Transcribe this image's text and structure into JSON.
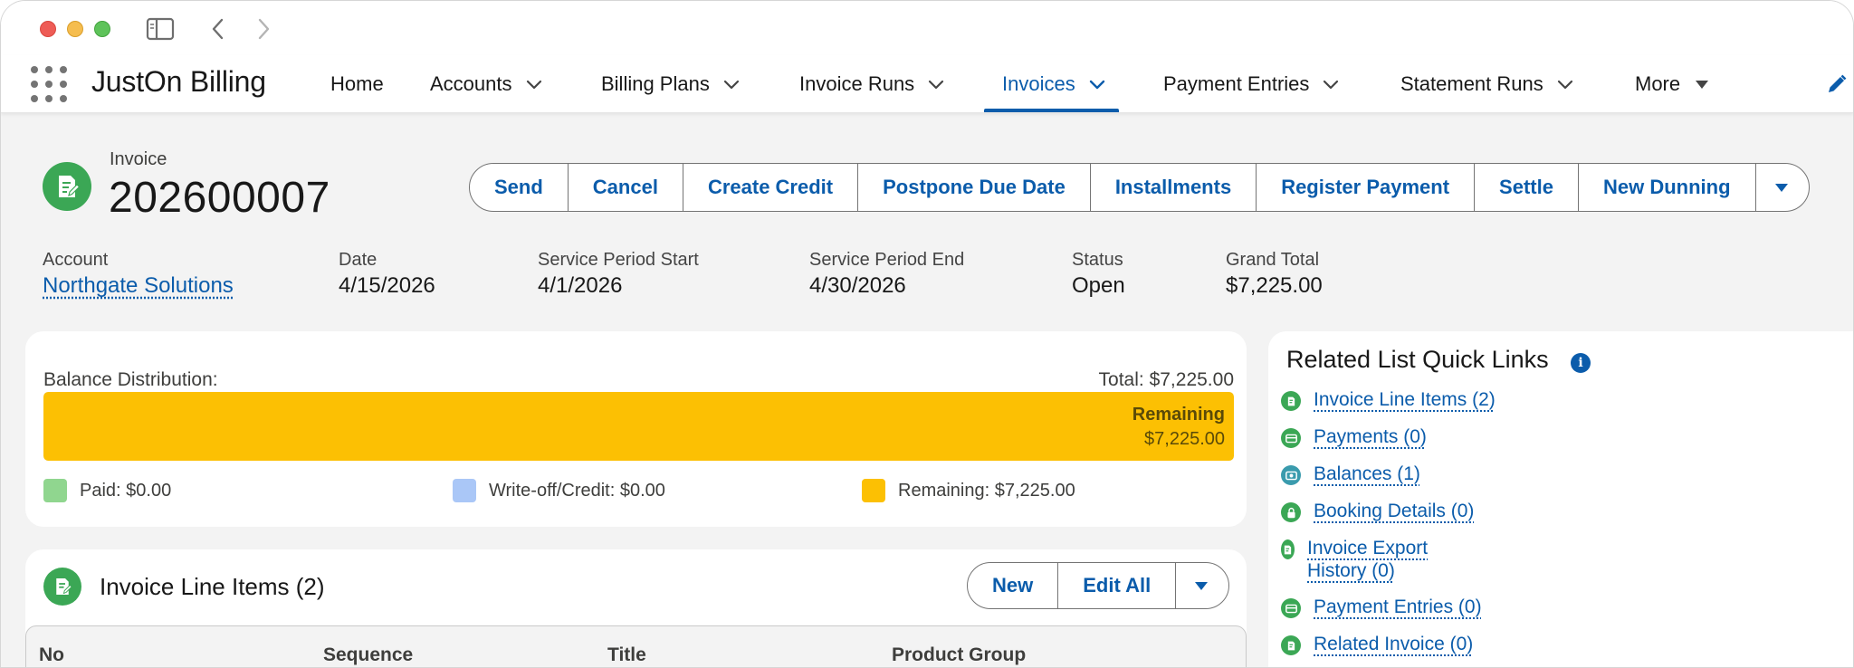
{
  "app": {
    "name": "JustOn Billing"
  },
  "nav": {
    "items": [
      {
        "label": "Home",
        "dropdown": false
      },
      {
        "label": "Accounts",
        "dropdown": true
      },
      {
        "label": "Billing Plans",
        "dropdown": true
      },
      {
        "label": "Invoice Runs",
        "dropdown": true
      },
      {
        "label": "Invoices",
        "dropdown": true,
        "active": true
      },
      {
        "label": "Payment Entries",
        "dropdown": true
      },
      {
        "label": "Statement Runs",
        "dropdown": true
      },
      {
        "label": "More",
        "dropdown": true
      }
    ],
    "accent_color": "#0b5cab"
  },
  "record": {
    "type": "Invoice",
    "title": "202600007",
    "icon": "invoice-icon",
    "icon_color": "#3ba755",
    "actions": [
      "Send",
      "Cancel",
      "Create Credit",
      "Postpone Due Date",
      "Installments",
      "Register Payment",
      "Settle",
      "New Dunning"
    ],
    "fields": {
      "account": {
        "label": "Account",
        "value": "Northgate Solutions"
      },
      "date": {
        "label": "Date",
        "value": "4/15/2026"
      },
      "service_start": {
        "label": "Service Period Start",
        "value": "4/1/2026"
      },
      "service_end": {
        "label": "Service Period End",
        "value": "4/30/2026"
      },
      "status": {
        "label": "Status",
        "value": "Open"
      },
      "grand_total": {
        "label": "Grand Total",
        "value": "$7,225.00"
      }
    }
  },
  "balance": {
    "title": "Balance Distribution:",
    "total": "Total: $7,225.00",
    "remaining_fraction": 1.0,
    "bar_label_title": "Remaining",
    "bar_label_value": "$7,225.00",
    "legend": [
      {
        "label": "Paid: $0.00",
        "color": "#90d68f"
      },
      {
        "label": "Write-off/Credit: $0.00",
        "color": "#aac7f7"
      },
      {
        "label": "Remaining: $7,225.00",
        "color": "#fcc003"
      }
    ]
  },
  "line_items": {
    "title": "Invoice Line Items (2)",
    "actions": [
      "New",
      "Edit All"
    ],
    "columns": [
      "No",
      "Sequence",
      "Title",
      "Product Group"
    ]
  },
  "quick_links": {
    "title": "Related List Quick Links",
    "links": [
      {
        "label": "Invoice Line Items (2)",
        "icon": "invoice-icon",
        "color": "#3ba755"
      },
      {
        "label": "Payments (0)",
        "icon": "card-icon",
        "color": "#3ba755"
      },
      {
        "label": "Balances (1)",
        "icon": "cash-icon",
        "color": "#3a9bad"
      },
      {
        "label": "Booking Details (0)",
        "icon": "lock-icon",
        "color": "#3ba755"
      },
      {
        "label": "Invoice Export History (0)",
        "icon": "invoice-icon",
        "color": "#3ba755"
      },
      {
        "label": "Payment Entries (0)",
        "icon": "card-icon",
        "color": "#3ba755"
      },
      {
        "label": "Related Invoice (0)",
        "icon": "invoice-icon",
        "color": "#3ba755"
      }
    ]
  }
}
